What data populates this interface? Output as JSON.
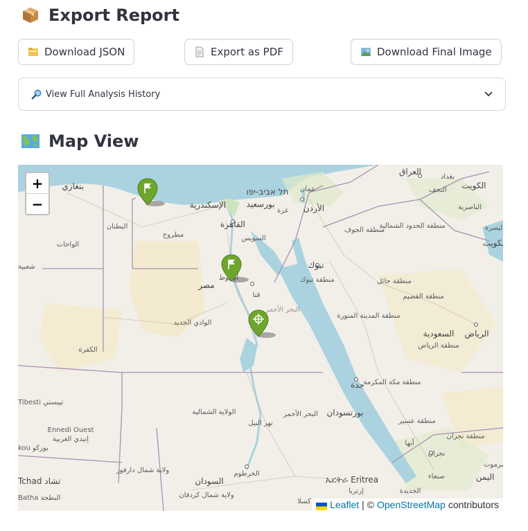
{
  "export": {
    "title": "Export Report",
    "icon": "package-icon",
    "buttons": {
      "json": "Download JSON",
      "pdf": "Export as PDF",
      "image": "Download Final Image"
    },
    "history": "View Full Analysis History"
  },
  "map_section": {
    "title": "Map View",
    "icon": "world-map-icon",
    "zoom_in": "+",
    "zoom_out": "−",
    "attribution": {
      "leaflet": "Leaflet",
      "separator": "| ©",
      "osm": "OpenStreetMap",
      "suffix": "contributors"
    },
    "labels": {
      "alexandria": "الإسكندرية",
      "portsaid": "بورسعيد",
      "cairo": "القاهرة",
      "suez": "السويس",
      "telaviv": "תל אביב-יפו",
      "amman": "عمان",
      "gaza": "غزة",
      "jordan": "الأردن",
      "baghdad": "بغداد",
      "iraq": "العراق",
      "najaf": "النجف",
      "kuwait": "الكويت",
      "nasiriyah": "الناصرية",
      "basra": "البصرة",
      "kuwait2": "الكويت",
      "benghazi": "بنغازي",
      "butnan": "البطنان",
      "matrouh": "مطروح",
      "wahat": "الواحات",
      "egypt": "مصر",
      "asyut": "أسيوط",
      "qena": "قنا",
      "wadi": "الوادي الجديد",
      "redsea": "البحر الأحمر",
      "tabuk": "تبوك",
      "tabukreg": "منطقة تبوك",
      "jawf": "منطقة الجوف",
      "northern": "منطقة الحدود الشمالية",
      "hail": "منطقة حائل",
      "qassim": "منطقة القصيم",
      "madinah": "منطقة المدينة المنورة",
      "riyadh": "الرياض",
      "saudi": "السعودية",
      "riyadhreg": "منطقة الرياض",
      "kufra": "الكفرة",
      "jeddah": "جدة",
      "makkah": "منطقة مكة المكرمة",
      "asir": "منطقة عسير",
      "najran": "منطقة نجران",
      "najrancity": "نجران",
      "abha": "أبها",
      "portsudan": "بورتسودان",
      "northstate": "الولاية الشمالية",
      "nilestate": "نهر النيل",
      "redseasd": "البحر الأحمر",
      "khartoum": "الخرطوم",
      "sudan": "السودان",
      "kassala": "كسلا",
      "eritrea": "ኤርትራ Eritrea",
      "asmara": "إرتريا",
      "yemen": "اليمن",
      "sanaa": "صنعاء",
      "hudaydah": "الحديدة",
      "ennedi": "Ennedi Ouest",
      "ennedi_ar": "إنيدي الغربية",
      "tibesti": "Tibesti تيبستي",
      "borkou": "kou بوركو",
      "tchad": "Tchad تشاد",
      "batha": "Batha البطحة",
      "darfur": "ولاية شمال دارفور",
      "kordofan": "ولاية شمال كردفان",
      "shabiya": "شعبية",
      "sarmout": "ضرموت"
    }
  }
}
